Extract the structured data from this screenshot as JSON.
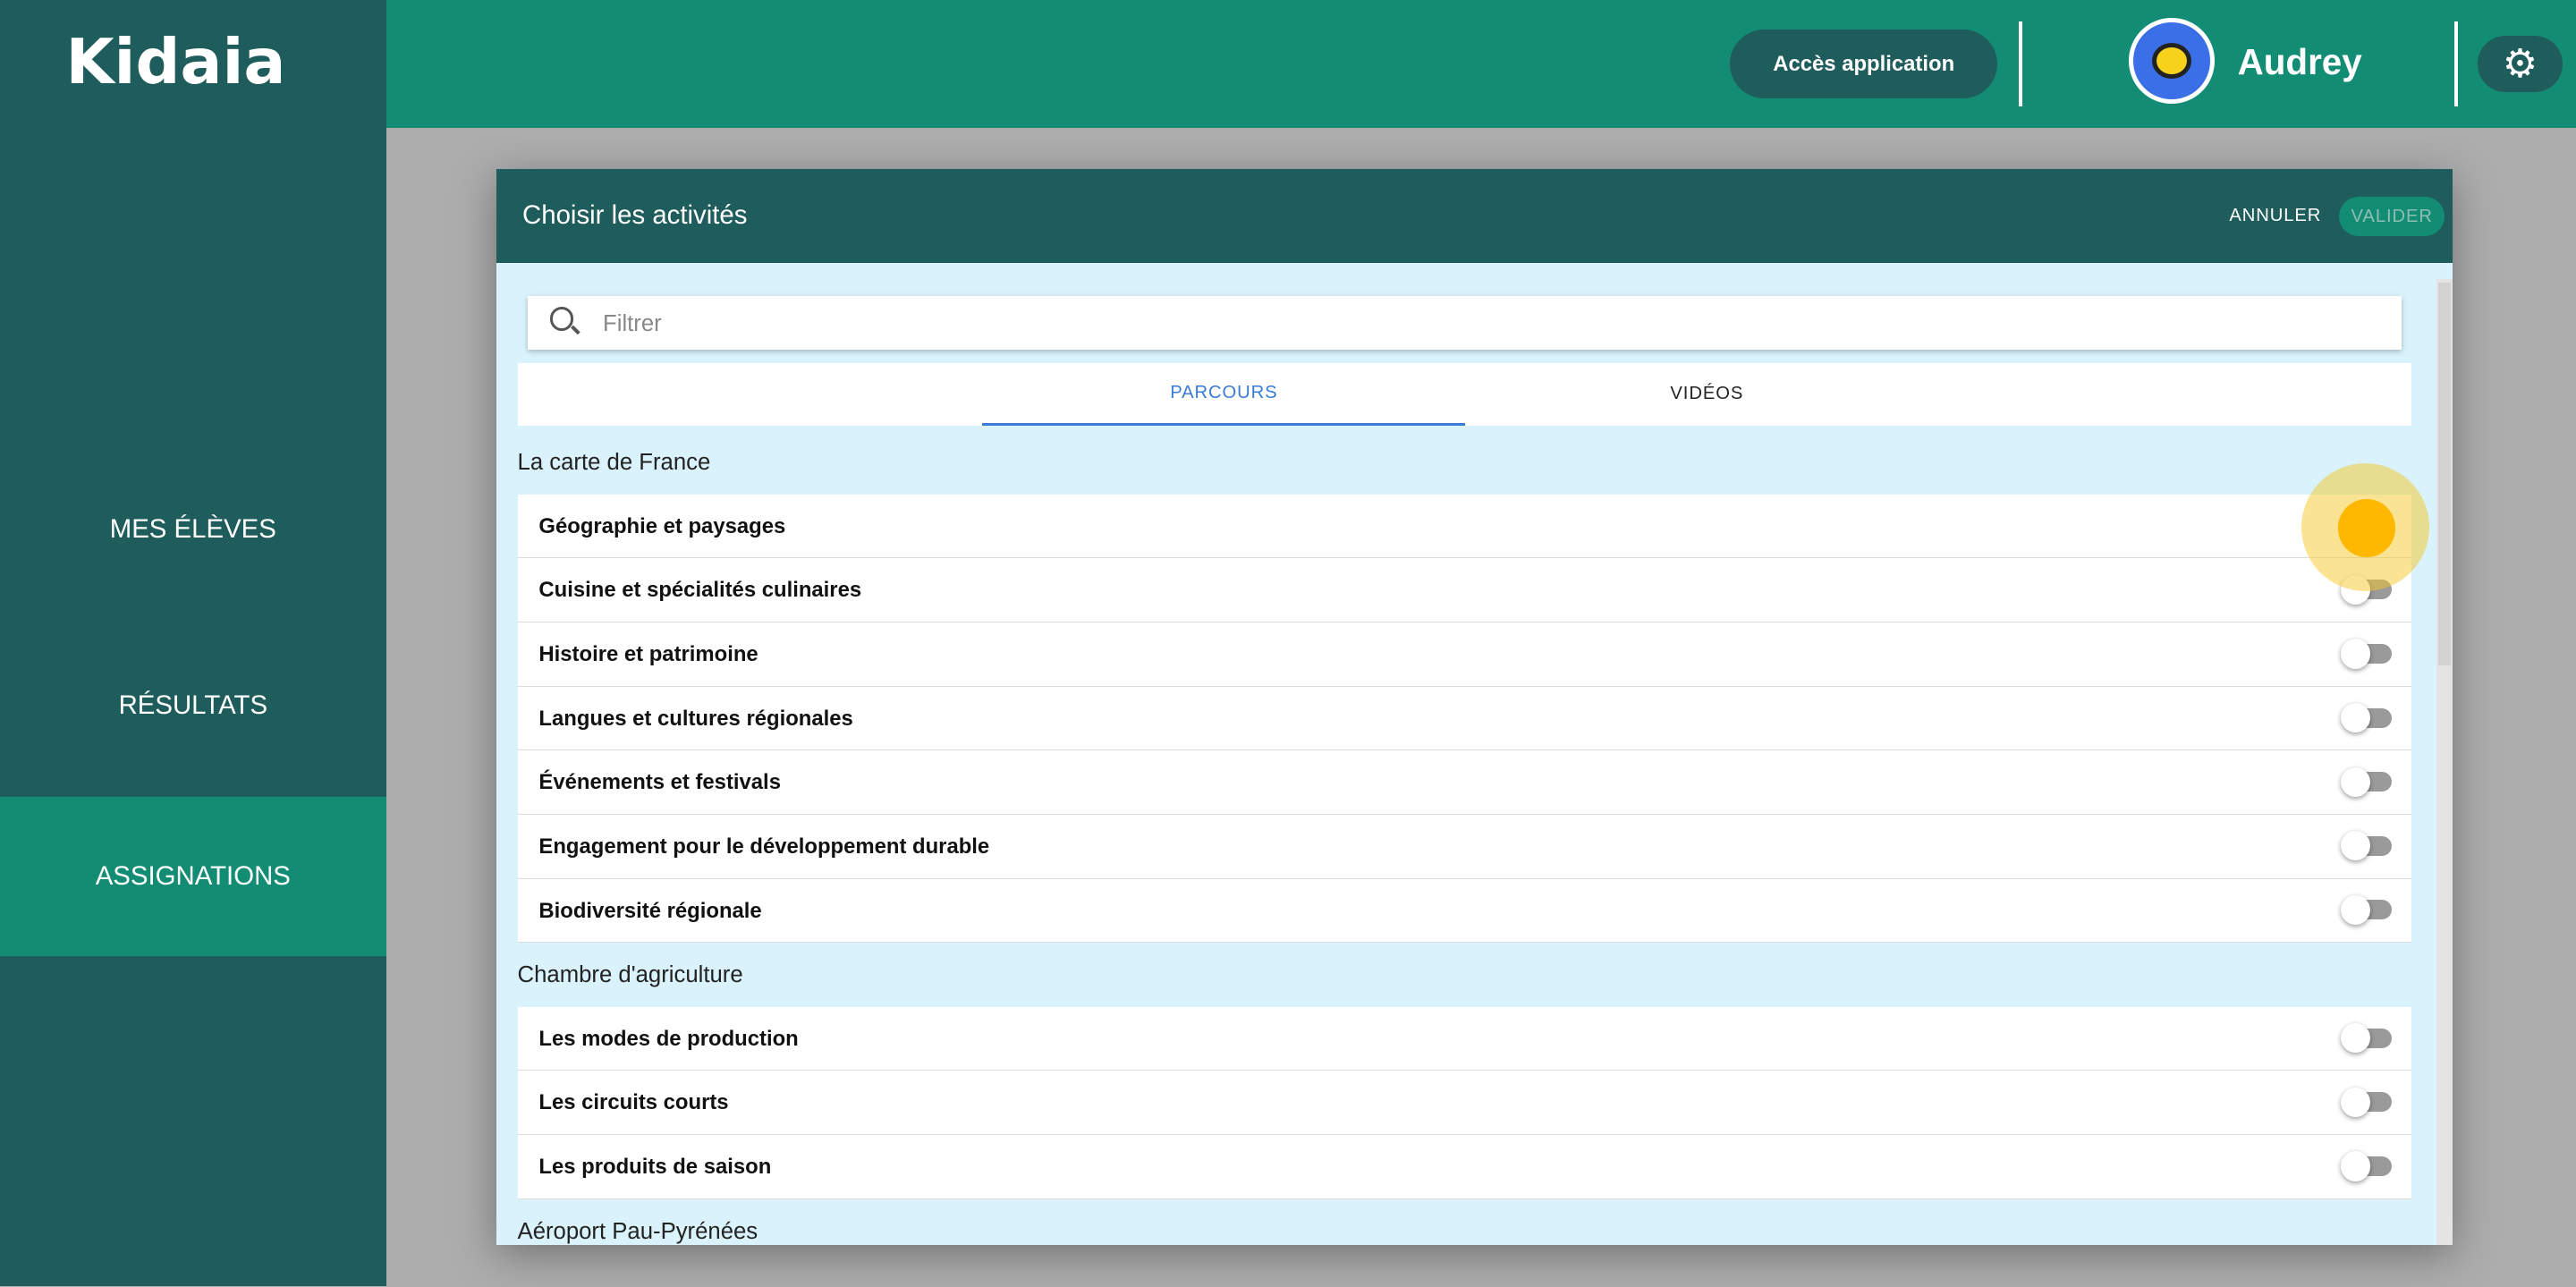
{
  "app": {
    "logo": "Kidaia"
  },
  "sidebar": {
    "items": [
      {
        "label": "MES ÉLÈVES"
      },
      {
        "label": "RÉSULTATS"
      },
      {
        "label": "ASSIGNATIONS",
        "active": true
      }
    ]
  },
  "header": {
    "access_button": "Accès application",
    "user_name": "Audrey",
    "settings_icon": "gear-icon"
  },
  "dialog": {
    "title": "Choisir les activités",
    "cancel": "ANNULER",
    "validate": "VALIDER",
    "search_placeholder": "Filtrer",
    "tabs": [
      {
        "label": "PARCOURS",
        "active": true
      },
      {
        "label": "VIDÉOS"
      }
    ],
    "sections": [
      {
        "title": "La carte de France",
        "items": [
          "Géographie et paysages",
          "Cuisine et spécialités culinaires",
          "Histoire et patrimoine",
          "Langues et cultures régionales",
          "Événements et festivals",
          "Engagement pour le développement durable",
          "Biodiversité régionale"
        ]
      },
      {
        "title": "Chambre d'agriculture",
        "items": [
          "Les modes de production",
          "Les circuits courts",
          "Les produits de saison"
        ]
      },
      {
        "title": "Aéroport Pau-Pyrénées",
        "items": []
      }
    ]
  },
  "colors": {
    "sidebar": "#1f5c5c",
    "topbar": "#128c73",
    "dialog_bg": "#d9f2fb",
    "tab_active": "#3a7bd5",
    "click_marker": "#ffb800"
  }
}
